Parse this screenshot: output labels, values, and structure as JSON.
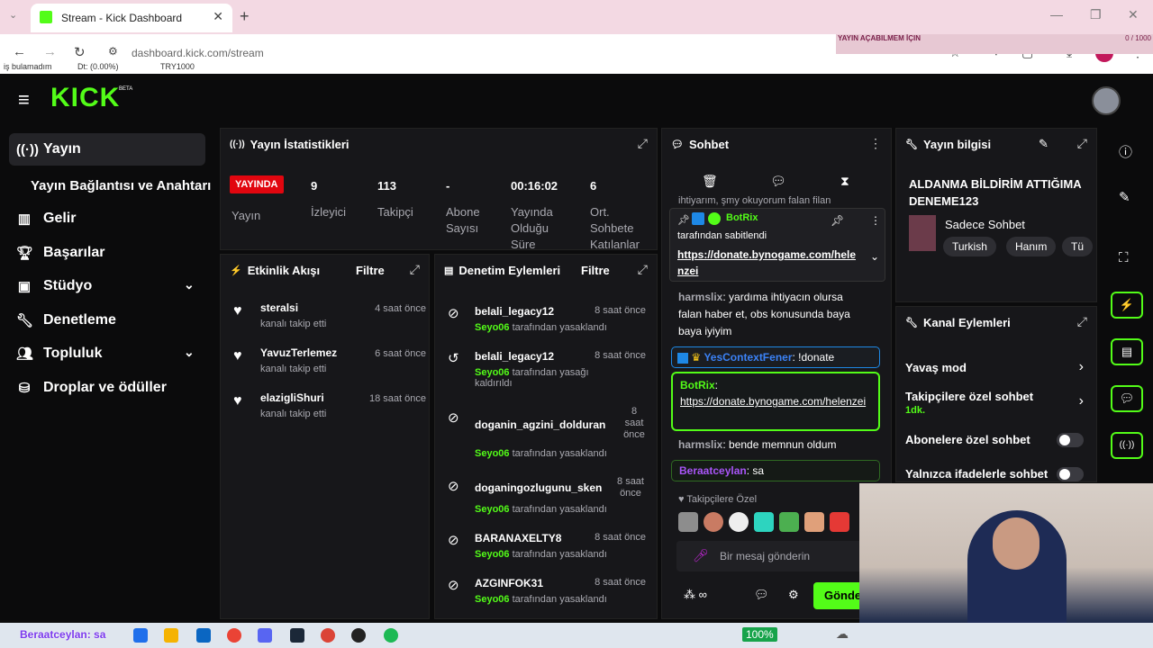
{
  "browser": {
    "tab_title": "Stream - Kick Dashboard",
    "url": "dashboard.kick.com/stream",
    "overlay_title": "YAYIN AÇABILMEM İÇIN",
    "overlay_progress": "0 / 1000",
    "ticker": [
      "iş bulamadım",
      "Dt: (0.00%)",
      "TRY1000"
    ]
  },
  "logo": "KICK",
  "logo_beta": "BETA",
  "nav": {
    "items": [
      {
        "label": "Yayın",
        "icon": "broadcast-icon"
      },
      {
        "label": "Yayın Bağlantısı ve Anahtarı",
        "icon": ""
      },
      {
        "label": "Gelir",
        "icon": "chart-icon"
      },
      {
        "label": "Başarılar",
        "icon": "trophy-icon"
      },
      {
        "label": "Stüdyo",
        "icon": "studio-icon"
      },
      {
        "label": "Denetleme",
        "icon": "wrench-icon"
      },
      {
        "label": "Topluluk",
        "icon": "community-icon"
      },
      {
        "label": "Droplar ve ödüller",
        "icon": "drops-icon"
      }
    ]
  },
  "stats": {
    "title": "Yayın İstatistikleri",
    "live_badge": "YAYINDA",
    "items": [
      {
        "value": "9",
        "label": "İzleyici"
      },
      {
        "value": "113",
        "label": "Takipçi"
      },
      {
        "value": "-",
        "label": "Abone Sayısı"
      },
      {
        "value": "00:16:02",
        "label": "Yayında Olduğu Süre"
      },
      {
        "value": "6",
        "label": "Ort. Sohbete Katılanlar"
      }
    ],
    "status_label": "Yayın"
  },
  "activity": {
    "title": "Etkinlik Akışı",
    "filter": "Filtre",
    "rows": [
      {
        "user": "steralsi",
        "sub": "kanalı takip etti",
        "time": "4 saat önce"
      },
      {
        "user": "YavuzTerlemez",
        "sub": "kanalı takip etti",
        "time": "6 saat önce"
      },
      {
        "user": "elazigliShuri",
        "sub": "kanalı takip etti",
        "time": "18 saat önce"
      }
    ]
  },
  "moderation": {
    "title": "Denetim Eylemleri",
    "filter": "Filtre",
    "rows": [
      {
        "user": "belali_legacy12",
        "by": "Seyo06",
        "action": "tarafından yasaklandı",
        "time": "8 saat önce"
      },
      {
        "user": "belali_legacy12",
        "by": "Seyo06",
        "action": "tarafından yasağı kaldırıldı",
        "time": "8 saat önce"
      },
      {
        "user": "doganin_agzini_dolduran",
        "by": "Seyo06",
        "action": "tarafından yasaklandı",
        "time": "8 saat önce"
      },
      {
        "user": "doganingozlugunu_sken",
        "by": "Seyo06",
        "action": "tarafından yasaklandı",
        "time": "8 saat önce"
      },
      {
        "user": "BARANAXELTY8",
        "by": "Seyo06",
        "action": "tarafından yasaklandı",
        "time": "8 saat önce"
      },
      {
        "user": "AZGINFOK31",
        "by": "Seyo06",
        "action": "tarafından yasaklandı",
        "time": "8 saat önce"
      }
    ]
  },
  "chat": {
    "title": "Sohbet",
    "top_text": "ihtiyarım, şmy okuyorum falan filan",
    "pinned_user": "BotRix",
    "pinned_by": "tarafından sabitlendi",
    "pinned_link": "https://donate.bynogame.com/helenzei",
    "messages": [
      {
        "user": "harmslix",
        "text": "yardıma ihtiyacın olursa falan haber et, obs konusunda baya baya iyiyim"
      },
      {
        "user": "YesContextFener",
        "text": "!donate"
      },
      {
        "user": "BotRix",
        "text": "https://donate.bynogame.com/helenzei"
      },
      {
        "user": "harmslix",
        "text": "bende memnun oldum"
      },
      {
        "user": "Beraatceylan",
        "text": "sa"
      }
    ],
    "followers_label": "Takipçilere Özel",
    "input_placeholder": "Bir mesaj gönderin",
    "send_label": "Gönder"
  },
  "info": {
    "title": "Yayın bilgisi",
    "stream_title": "ALDANMA BİLDİRİM ATTIĞIMA DENEME123",
    "category": "Sadece Sohbet",
    "tags": [
      "Turkish",
      "Hanım",
      "Tü"
    ]
  },
  "channel": {
    "title": "Kanal Eylemleri",
    "rows": [
      {
        "label": "Yavaş mod",
        "sub": ""
      },
      {
        "label": "Takipçilere özel sohbet",
        "sub": "1dk."
      },
      {
        "label": "Abonelere özel sohbet",
        "sub": ""
      },
      {
        "label": "Yalnızca ifadelerle sohbet",
        "sub": ""
      }
    ]
  },
  "taskbar": {
    "chat_overlay": "Beraatceylan: sa",
    "battery": "100%"
  },
  "colors": {
    "accent": "#53fc18",
    "live": "#e1060f"
  }
}
